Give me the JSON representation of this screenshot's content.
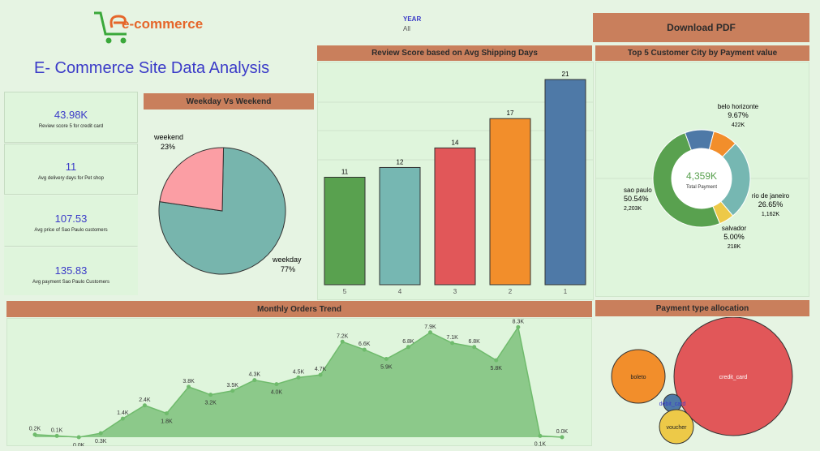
{
  "logo": {
    "text": "e-commerce"
  },
  "title": "E- Commerce Site Data Analysis",
  "filter": {
    "label": "YEAR",
    "value": "All"
  },
  "download_label": "Download PDF",
  "kpis": [
    {
      "value": "43.98K",
      "label": "Review score 5 for credit card"
    },
    {
      "value": "11",
      "label": "Avg delivery days for Pet shop"
    },
    {
      "value": "107.53",
      "label": "Avg price of Sao Paulo customers"
    },
    {
      "value": "135.83",
      "label": "Avg payment Sao Paulo Customers"
    }
  ],
  "colors": {
    "header": "#c97f5c",
    "kpi_value": "#3a3ac8",
    "panel_bg": "#dff5dc"
  },
  "chart_data": [
    {
      "type": "pie",
      "title": "Weekday Vs Weekend",
      "slices": [
        {
          "name": "weekday",
          "value": 77,
          "label": "77%",
          "color": "#77b5ad"
        },
        {
          "name": "weekend",
          "value": 23,
          "label": "23%",
          "color": "#fb9ea4"
        }
      ]
    },
    {
      "type": "bar",
      "title": "Review Score based on Avg Shipping Days",
      "categories": [
        "5",
        "4",
        "3",
        "2",
        "1"
      ],
      "values": [
        11,
        12,
        14,
        17,
        21
      ],
      "colors": [
        "#59a14f",
        "#76b7b2",
        "#e15759",
        "#f28e2b",
        "#4e79a7"
      ],
      "ylim": [
        0,
        22
      ]
    },
    {
      "type": "pie",
      "title": "Top 5 Customer City by Payment value",
      "center_value": "4,359K",
      "center_label": "Total Payment",
      "slices": [
        {
          "name": "sao paulo",
          "value": 50.54,
          "pct": "50.54%",
          "amount": "2,203K",
          "color": "#59a14f"
        },
        {
          "name": "belo horizonte",
          "value": 9.67,
          "pct": "9.67%",
          "amount": "422K",
          "color": "#4e79a7"
        },
        {
          "name": "",
          "value": 8.14,
          "color": "#f28e2b"
        },
        {
          "name": "rio de janeiro",
          "value": 26.65,
          "pct": "26.65%",
          "amount": "1,162K",
          "color": "#76b7b2"
        },
        {
          "name": "salvador",
          "value": 5.0,
          "pct": "5.00%",
          "amount": "218K",
          "color": "#edc948"
        }
      ]
    },
    {
      "type": "area",
      "title": "Monthly Orders Trend",
      "values": [
        0.2,
        0.1,
        0.0,
        0.3,
        1.4,
        2.4,
        1.8,
        3.8,
        3.2,
        3.5,
        4.3,
        4.0,
        4.5,
        4.7,
        7.2,
        6.6,
        5.9,
        6.8,
        7.9,
        7.1,
        6.8,
        5.8,
        8.3,
        0.1,
        0.0
      ],
      "labels": [
        "0.2K",
        "0.1K",
        "0.0K",
        "0.3K",
        "1.4K",
        "2.4K",
        "1.8K",
        "3.8K",
        "3.2K",
        "3.5K",
        "4.3K",
        "4.0K",
        "4.5K",
        "4.7K",
        "7.2K",
        "6.6K",
        "5.9K",
        "6.8K",
        "7.9K",
        "7.1K",
        "6.8K",
        "5.8K",
        "8.3K",
        "0.1K",
        "0.0K"
      ],
      "ylim": [
        0,
        8.5
      ],
      "color": "#8cc98a"
    },
    {
      "type": "bubble",
      "title": "Payment type allocation",
      "items": [
        {
          "name": "credit_card",
          "color": "#e15759"
        },
        {
          "name": "boleto",
          "color": "#f28e2b"
        },
        {
          "name": "debit_card",
          "color": "#4e79a7"
        },
        {
          "name": "voucher",
          "color": "#edc948"
        }
      ]
    }
  ]
}
